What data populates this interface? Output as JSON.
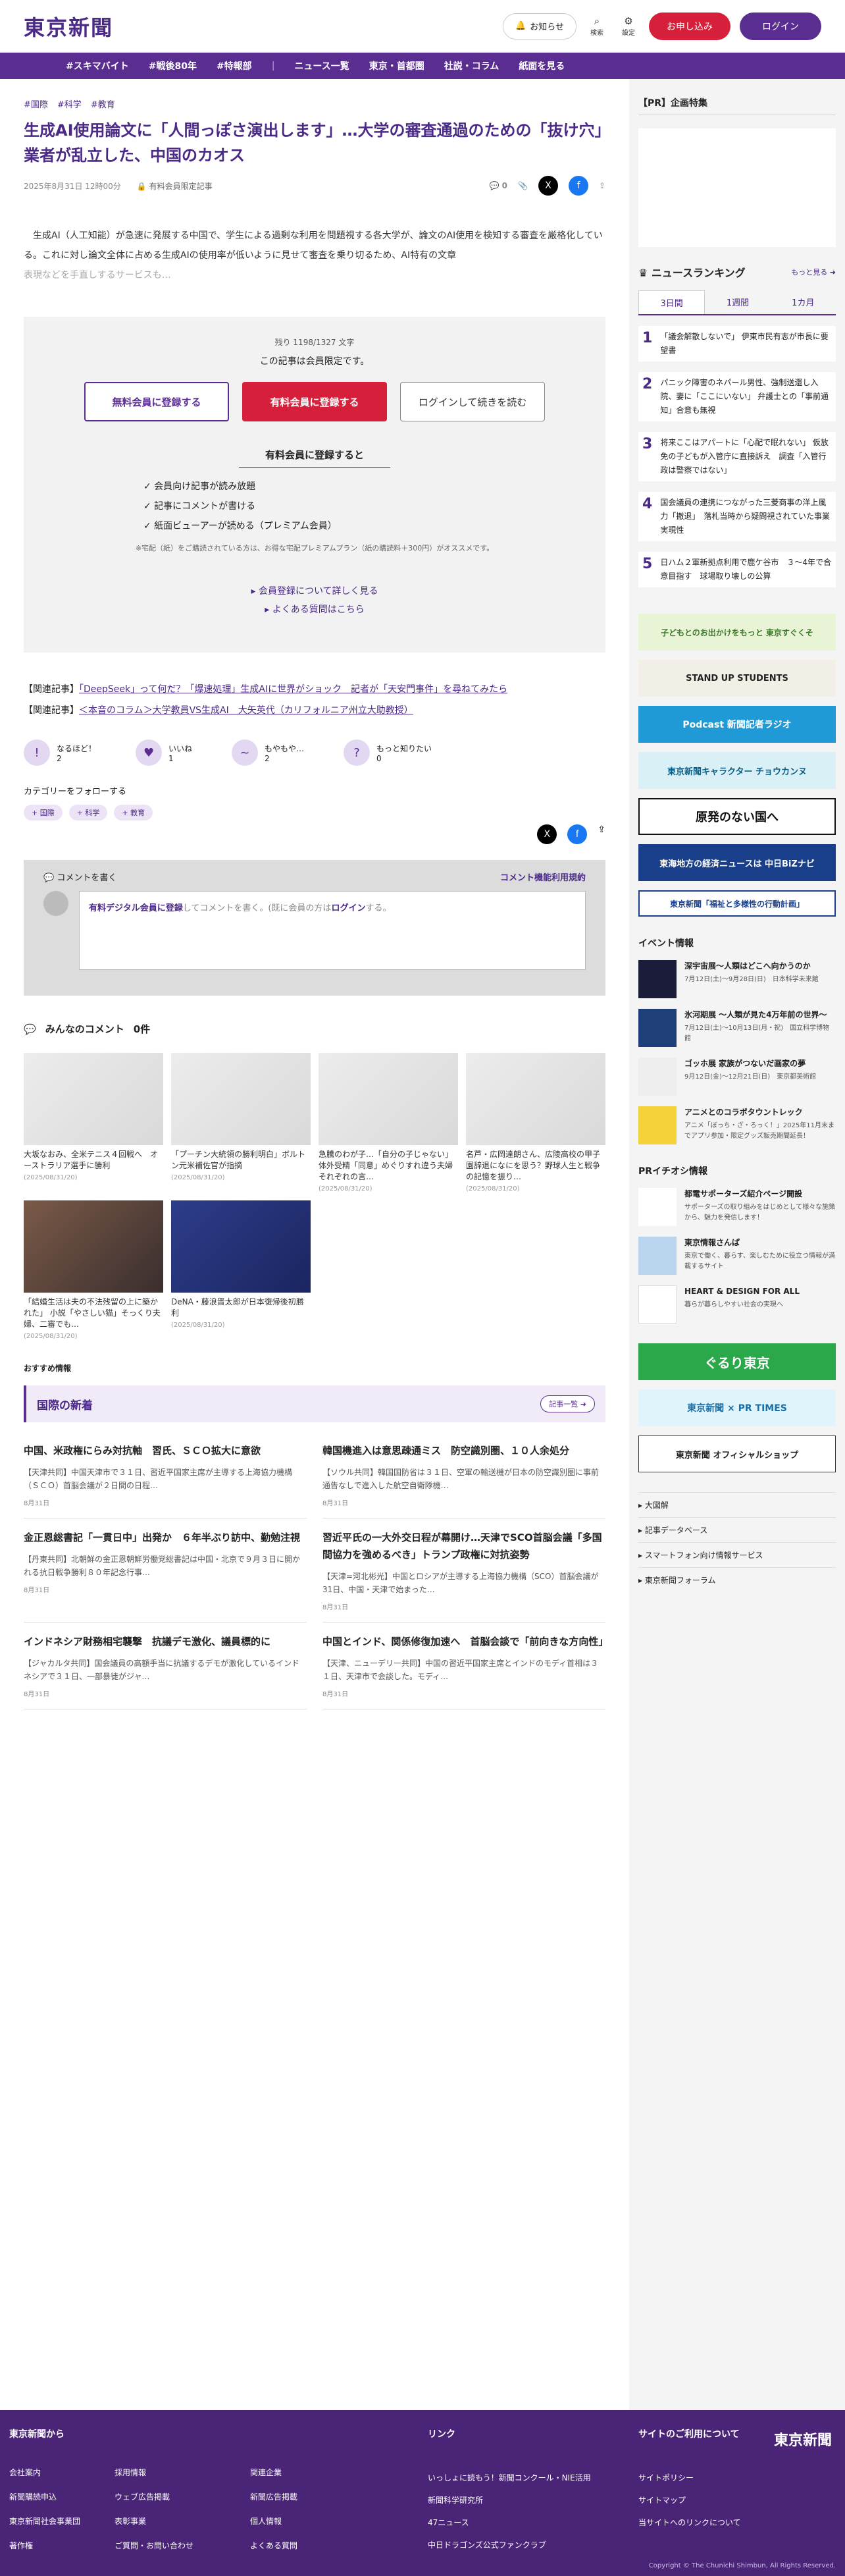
{
  "site": {
    "logo": "東京新聞"
  },
  "header": {
    "notify": "お知らせ",
    "search": "検索",
    "settings": "設定",
    "signup": "お申し込み",
    "login": "ログイン"
  },
  "nav": [
    "#スキマバイト",
    "#戦後80年",
    "#特報部",
    "ニュース一覧",
    "東京・首都圏",
    "社説・コラム",
    "紙面を見る"
  ],
  "article": {
    "tags": [
      "#国際",
      "#科学",
      "#教育"
    ],
    "title": "生成AI使用論文に「人間っぽさ演出します」…大学の審査通過のための「抜け穴」業者が乱立した、中国のカオス",
    "date": "2025年8月31日 12時00分",
    "member_only": "有料会員限定記事",
    "comments": "0",
    "lead": "　生成AI（人工知能）が急速に発展する中国で、学生による過剰な利用を問題視する各大学が、論文のAI使用を検知する審査を厳格化している。これに対し論文全体に占める生成AIの使用率が低いように見せて審査を乗り切るため、AI特有の文章",
    "lead_fade": "表現などを手直しするサービスも…"
  },
  "paywall": {
    "remaining": "残り 1198/1327 文字",
    "only": "この記事は会員限定です。",
    "free": "無料会員に登録する",
    "paid": "有料会員に登録する",
    "login": "ログインして続きを読む",
    "benefit_title": "有料会員に登録すると",
    "benefits": [
      "✓ 会員向け記事が読み放題",
      "✓ 記事にコメントが書ける",
      "✓ 紙面ビューアーが読める（プレミアム会員）"
    ],
    "note": "※宅配（紙）をご購読されている方は、お得な宅配プレミアムプラン（紙の購読料＋300円）がオススメです。",
    "link1": "▸ 会員登録について詳しく見る",
    "link2": "▸ よくある質問はこちら"
  },
  "related": [
    {
      "label": "【関連記事】",
      "text": "「DeepSeek」って何だ？「爆速処理」生成AIに世界がショック　記者が「天安門事件」を尋ねてみたら"
    },
    {
      "label": "【関連記事】",
      "text": "＜本音のコラム＞大学教員VS生成AI　大矢英代（カリフォルニア州立大助教授）"
    }
  ],
  "reactions": [
    {
      "icon": "!",
      "label": "なるほど！",
      "count": "2"
    },
    {
      "icon": "♥",
      "label": "いいね",
      "count": "1"
    },
    {
      "icon": "~",
      "label": "もやもや…",
      "count": "2"
    },
    {
      "icon": "?",
      "label": "もっと知りたい",
      "count": "0"
    }
  ],
  "follow": {
    "title": "カテゴリーをフォローする",
    "cats": [
      "+ 国際",
      "+ 科学",
      "+ 教育"
    ]
  },
  "comment": {
    "write": "コメントを書く",
    "rule": "コメント機能利用規約",
    "link": "有料デジタル会員に登録",
    "text": "してコメントを書く。(既に会員の方は",
    "login": "ログイン",
    "end": "する。"
  },
  "all_comments": {
    "label": "みんなのコメント",
    "count": "0件"
  },
  "cards": [
    {
      "cap": "大坂なおみ、全米テニス４回戦へ　オーストラリア選手に勝利",
      "dt": "(2025/08/31/20)"
    },
    {
      "cap": "「プーチン大統領の勝利明白」ボルトン元米補佐官が指摘",
      "dt": "(2025/08/31/20)"
    },
    {
      "cap": "急騰のわが子…「自分の子じゃない」体外受精「同意」めぐりすれ違う夫婦　それぞれの言…",
      "dt": "(2025/08/31/20)"
    },
    {
      "cap": "名芦・広岡達朗さん、広陵高校の甲子園辞退になにを思う？野球人生と戦争の記憶を振り…",
      "dt": "(2025/08/31/20)"
    },
    {
      "cap": "「結婚生活は夫の不法残留の上に築かれた」 小説「やさしい猫」そっくり夫婦、二審でも…",
      "dt": "(2025/08/31/20)"
    },
    {
      "cap": "DeNA・藤浪晋太郎が日本復帰後初勝利",
      "dt": "(2025/08/31/20)"
    }
  ],
  "recommend": "おすすめ情報",
  "intl": {
    "title": "国際の新着",
    "more": "記事一覧 ➜",
    "items": [
      {
        "h": "中国、米政権にらみ対抗軸　習氏、ＳＣＯ拡大に意欲",
        "b": "【天津共同】中国天津市で３１日、習近平国家主席が主導する上海協力機構（ＳＣＯ）首脳会議が２日間の日程…",
        "d": "8月31日"
      },
      {
        "h": "韓国機進入は意思疎通ミス　防空識別圏、１０人余処分",
        "b": "【ソウル共同】韓国国防省は３１日、空軍の輸送機が日本の防空識別圏に事前通告なしで進入した航空自衛隊機…",
        "d": "8月31日"
      },
      {
        "h": "金正恩総書記「一貫日中」出発か　６年半ぶり訪中、勤勉注視",
        "b": "【丹東共同】北朝鮮の金正恩朝鮮労働党総書記は中国・北京で９月３日に開かれる抗日戦争勝利８０年記念行事…",
        "d": "8月31日"
      },
      {
        "h": "習近平氏の一大外交日程が幕開け…天津でSCO首脳会議「多国間協力を強めるべき」トランプ政権に対抗姿勢",
        "b": "【天津=河北彬光】中国とロシアが主導する上海協力機構（SCO）首脳会議が31日、中国・天津で始まった…",
        "d": "8月31日"
      },
      {
        "h": "インドネシア財務相宅襲撃　抗議デモ激化、議員標的に",
        "b": "【ジャカルタ共同】国会議員の高額手当に抗議するデモが激化しているインドネシアで３１日、一部暴徒がジャ…",
        "d": "8月31日"
      },
      {
        "h": "中国とインド、関係修復加速へ　首脳会談で「前向きな方向性」",
        "b": "【天津、ニューデリー共同】中国の習近平国家主席とインドのモディ首相は３１日、天津市で会談した。モディ…",
        "d": "8月31日"
      }
    ]
  },
  "side": {
    "pr": "【PR】企画特集",
    "ranking_title": "ニュースランキング",
    "ranking_more": "もっと見る ➜",
    "tabs": [
      "3日間",
      "1週間",
      "1カ月"
    ],
    "ranks": [
      {
        "n": "1",
        "t": "「議会解散しないで」 伊東市民有志が市長に要望書"
      },
      {
        "n": "2",
        "t": "パニック障害のネパール男性、強制送還し入院、妻に「ここにいない」 弁護士との「事前通知」合意も無視"
      },
      {
        "n": "3",
        "t": "将来ここはアパートに「心配で眠れない」 仮放免の子どもが入管庁に直接訴え　調査「入管行政は警察ではない」"
      },
      {
        "n": "4",
        "t": "国会議員の連携につながった三菱商事の洋上風力「撤退」　落札当時から疑問視されていた事業実現性"
      },
      {
        "n": "5",
        "t": "日ハム２軍新拠点利用で鹿ケ谷市　３〜4年で合意目指す　球場取り壊しの公算"
      }
    ],
    "banners": [
      "子どもとのお出かけをもっと 東京すぐくそ",
      "STAND UP STUDENTS",
      "Podcast 新聞記者ラジオ",
      "東京新聞キャラクター チョウカンヌ",
      "原発のない国へ",
      "東海地方の経済ニュースは 中日BiZナビ",
      "東京新聞「福祉と多様性の行動計画」"
    ],
    "event_title": "イベント情報",
    "events": [
      {
        "t": "深宇宙展〜人類はどこへ向かうのか",
        "b": "7月12日(土)〜9月28日(日)　日本科学未来館"
      },
      {
        "t": "氷河期展 〜人類が見た4万年前の世界〜",
        "b": "7月12日(土)〜10月13日(月・祝)　国立科学博物館"
      },
      {
        "t": "ゴッホ展 家族がつないだ画家の夢",
        "b": "9月12日(金)〜12月21日(日)　東京都美術館"
      },
      {
        "t": "アニメとのコラボタウントレック",
        "b": "アニメ「ぼっち・ざ・ろっく！」2025年11月末までアプリ参加・限定グッズ販売期間延長！"
      }
    ],
    "pri_title": "PRイチオシ情報",
    "pri": [
      {
        "t": "都電サポーターズ紹介ページ開設",
        "b": "サポーターズの取り組みをはじめとして様々な施策から、魅力を発信します！"
      },
      {
        "t": "東京情報さんぱ",
        "b": "東京で働く、暮らす、楽しむために役立つ情報が満載するサイト"
      },
      {
        "t": "HEART & DESIGN FOR ALL",
        "b": "暮らが暮らしやすい社会の実現へ"
      }
    ],
    "bottom_banners": [
      "ぐるり東京",
      "東京新聞 × PR TIMES",
      "東京新聞 オフィシャルショップ"
    ],
    "links": [
      "▸ 大図解",
      "▸ 記事データベース",
      "▸ スマートフォン向け情報サービス",
      "▸ 東京新聞フォーラム"
    ]
  },
  "footer": {
    "col1": "東京新聞から",
    "col2": "リンク",
    "col3": "サイトのご利用について",
    "grid": [
      "会社案内",
      "採用情報",
      "関連企業",
      "新聞購読申込",
      "ウェブ広告掲載",
      "新聞広告掲載",
      "東京新聞社会事業団",
      "表彰事業",
      "個人情報",
      "著作権",
      "ご質問・お問い合わせ",
      "よくある質問"
    ],
    "links": [
      "いっしょに読もう！新聞コンクール・NIE活用",
      "新聞科学研究所",
      "47ニュース",
      "中日ドラゴンズ公式ファンクラブ"
    ],
    "site": [
      "サイトポリシー",
      "サイトマップ",
      "当サイトへのリンクについて"
    ],
    "logo": "東京新聞",
    "copy": "Copyright © The Chunichi Shimbun, All Rights Reserved."
  }
}
